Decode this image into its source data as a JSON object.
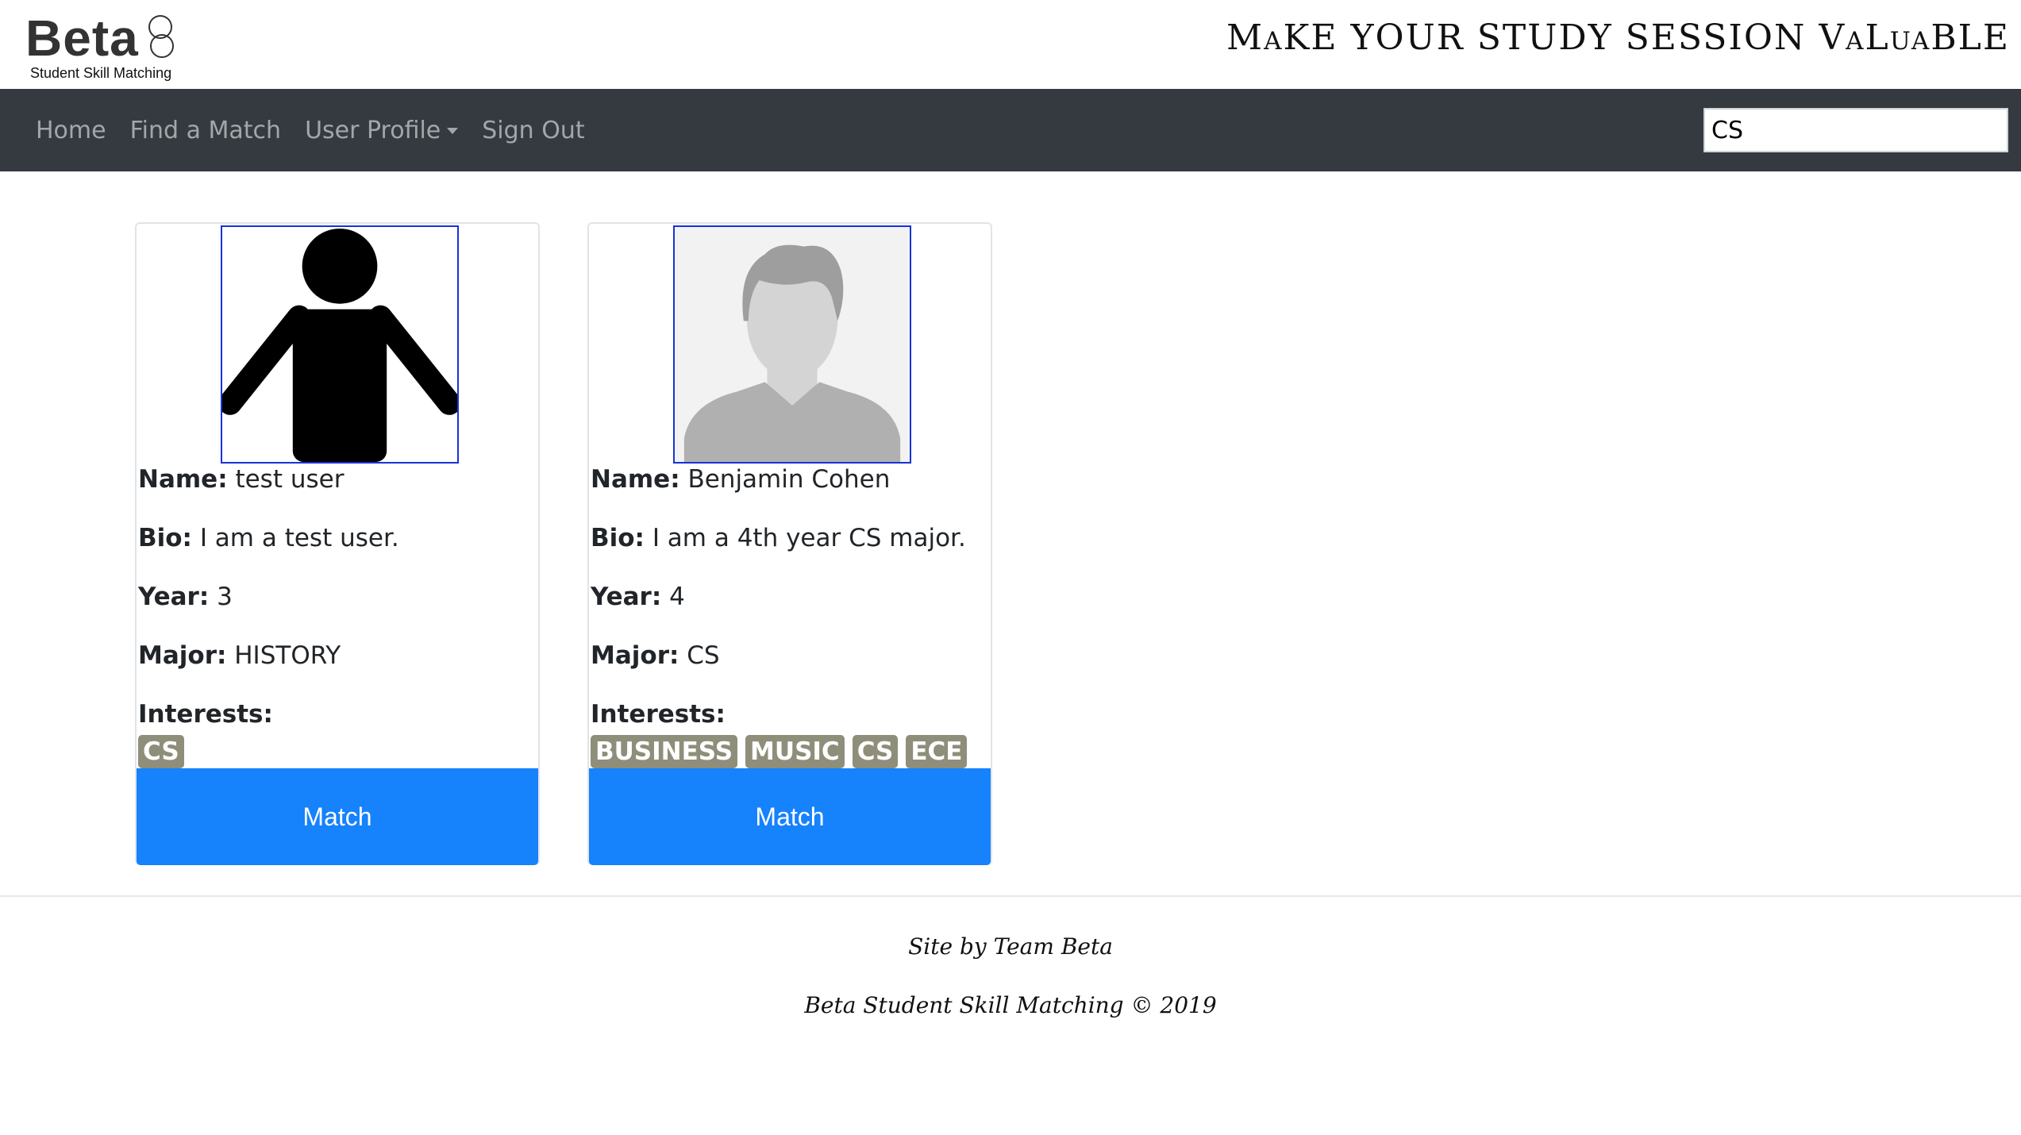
{
  "header": {
    "logo_text": "Beta",
    "logo_subtitle": "Student Skill Matching",
    "tagline": "MaKE YOUR STUDY SESSION VaLuaBLE"
  },
  "nav": {
    "items": [
      {
        "label": "Home"
      },
      {
        "label": "Find a Match"
      },
      {
        "label": "User Profile"
      },
      {
        "label": "Sign Out"
      }
    ],
    "search_value": "CS"
  },
  "labels": {
    "name": "Name:",
    "bio": "Bio:",
    "year": "Year:",
    "major": "Major:",
    "interests": "Interests:",
    "match_button": "Match"
  },
  "cards": [
    {
      "avatar_icon": "stick-figure-icon",
      "name": "test user",
      "bio": "I am a test user.",
      "year": "3",
      "major": "HISTORY",
      "interests": [
        "CS"
      ]
    },
    {
      "avatar_icon": "default-profile-silhouette-icon",
      "name": "Benjamin Cohen",
      "bio": "I am a 4th year CS major.",
      "year": "4",
      "major": "CS",
      "interests": [
        "BUSINESS",
        "MUSIC",
        "CS",
        "ECE"
      ]
    }
  ],
  "footer": {
    "credit": "Site by Team Beta",
    "copyright": "Beta Student Skill Matching © 2019"
  },
  "colors": {
    "navbar_bg": "#343a40",
    "match_button": "#1682fb",
    "tag_bg": "#8e8e7a",
    "avatar_border": "#1733d8",
    "logo_accent": "#e84a55"
  }
}
